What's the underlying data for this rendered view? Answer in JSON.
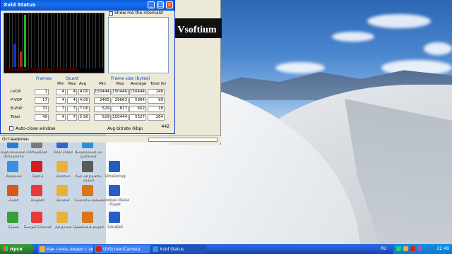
{
  "xvid_window": {
    "title": "Xvid Status",
    "show_internals_label": "Show me the internals!",
    "graph_numbers": "1234567890123456789012345678901",
    "groups": {
      "frames": "Frames",
      "quant": "Quant",
      "frame_size": "Frame size (bytes)"
    },
    "quant_headers": [
      "Min",
      "Max",
      "Avg"
    ],
    "size_headers": [
      "Min",
      "Max",
      "Average",
      "Total (k)"
    ],
    "rows": [
      {
        "label": "I-VOP",
        "frames": "1",
        "qmin": "4",
        "qmax": "4",
        "qavg": "4.00",
        "smin": "150444",
        "smax": "150444",
        "savg": "150444",
        "total": "146"
      },
      {
        "label": "P-VOP",
        "frames": "17",
        "qmin": "4",
        "qmax": "4",
        "qavg": "4.00",
        "smin": "2465",
        "smax": "29663",
        "savg": "5984",
        "total": "99"
      },
      {
        "label": "B-VOP",
        "frames": "31",
        "qmin": "7",
        "qmax": "7",
        "qavg": "7.00",
        "smin": "529",
        "smax": "817",
        "savg": "602",
        "total": "18"
      },
      {
        "label": "Total",
        "frames": "49",
        "qmin": "4",
        "qmax": "7",
        "qavg": "5.90",
        "smin": "529",
        "smax": "150444",
        "savg": "5527",
        "total": "264"
      }
    ],
    "auto_close_label": "Auto-close window",
    "avg_bitrate_label": "Avg bitrate (kbps):",
    "avg_bitrate_value": "442",
    "graph_bars": [
      {
        "color": "#1b2fd8",
        "level": 0.45
      },
      {
        "color": "#d81b1b",
        "level": 0.3
      },
      {
        "color": "#28b828",
        "level": 1.0
      }
    ]
  },
  "background_window": {
    "banner_text": "Vsoftium",
    "status_text": "Остановлен"
  },
  "desktop_icons": [
    {
      "label": "Подключение к Интернету",
      "color": "#2a7bd8"
    },
    {
      "label": "VirtualDub",
      "color": "#7a7a7a"
    },
    {
      "label": "Total Video",
      "color": "#3366cc"
    },
    {
      "label": "Выделение на рабочем",
      "color": "#2c8fd6"
    },
    {
      "label": "Корзина",
      "color": "#3a8ee6"
    },
    {
      "label": "Opera",
      "color": "#d81b1b"
    },
    {
      "label": "Autorun",
      "color": "#e8b23a"
    },
    {
      "label": "Как загрузить видео",
      "color": "#5a5a5a"
    },
    {
      "label": "UltraDefrag",
      "color": "#1f5fbf"
    },
    {
      "label": "Avast",
      "color": "#d85a1b"
    },
    {
      "label": "Яндекс",
      "color": "#e83a3a"
    },
    {
      "label": "Записи",
      "color": "#e8b23a"
    },
    {
      "label": "Скачать новые",
      "color": "#d8761b"
    },
    {
      "label": "Windows Media Player",
      "color": "#2a5cc9"
    },
    {
      "label": "Сброс",
      "color": "#3a9e3a"
    },
    {
      "label": "Google Chrome",
      "color": "#e83a3a"
    },
    {
      "label": "Загрузка",
      "color": "#e8b23a"
    },
    {
      "label": "Ошибки в видео",
      "color": "#d8761b"
    },
    {
      "label": "UltraEdit",
      "color": "#2a5cc9"
    }
  ],
  "taskbar": {
    "start_label": "пуск",
    "tasks": [
      {
        "label": "Как снять видео с экрана",
        "color": "#e8b23a"
      },
      {
        "label": "UVScreenCamera",
        "color": "#d81b1b"
      },
      {
        "label": "Xvid Status",
        "color": "#3a8ee6"
      }
    ],
    "language": "RU",
    "clock": "22:49"
  }
}
